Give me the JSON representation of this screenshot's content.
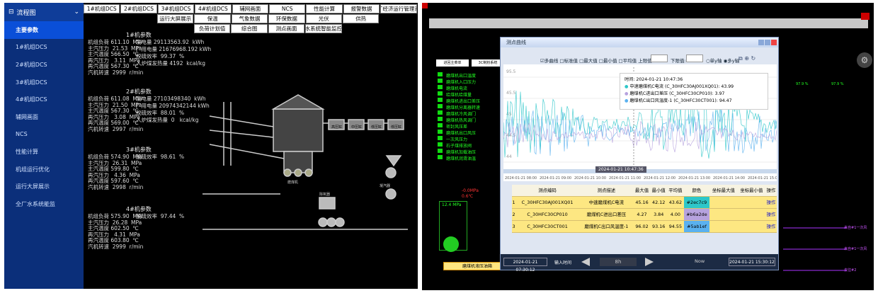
{
  "left_app": {
    "title": "流程图",
    "sidebar": [
      {
        "label": "主要参数",
        "active": true
      },
      {
        "label": "1#机组DCS"
      },
      {
        "label": "2#机组DCS"
      },
      {
        "label": "3#机组DCS"
      },
      {
        "label": "4#机组DCS"
      },
      {
        "label": "辅网画面"
      },
      {
        "label": "NCS"
      },
      {
        "label": "性能计算"
      },
      {
        "label": "机组运行优化"
      },
      {
        "label": "运行大屏展示"
      },
      {
        "label": "全厂水系统能监"
      }
    ],
    "topbar_row1": [
      "1#机组DCS",
      "2#机组DCS",
      "3#机组DCS",
      "4#机组DCS",
      "辅网画面",
      "NCS",
      "性能计算",
      "报警数据",
      "全厂经济运行管理系统"
    ],
    "topbar_row2": [
      "运行大屏展示",
      "保温",
      "气象数据",
      "环保数据",
      "光伏",
      "供热"
    ],
    "topbar_row3": [
      "负荷计划值",
      "综合图",
      "测点画面",
      "水系统智能监控"
    ],
    "units": [
      {
        "title": "1#机参数",
        "lines": [
          "机组负荷 611.10  MW",
          "主汽压力  21.53  MPa",
          "主汽温度 566.50  ℃",
          "再汽压力   3.11  MPa",
          "再汽温度 567.30  ℃",
          "汽机转速  2999  r/min"
        ],
        "extra": [
          "发电量 29113563.92  kWh",
          "厂用电量 21676968.192 kWh",
          "脱硫效率  99.37  %",
          "入炉煤发热量 4192  kcal/kg"
        ]
      },
      {
        "title": "2#机参数",
        "lines": [
          "机组负荷 611.08  MW",
          "主汽压力  21.50  MPa",
          "主汽温度 567.30  ℃",
          "再汽压力   3.08  MPa",
          "再汽温度 569.00  ℃",
          "汽机转速  2997  r/min"
        ],
        "extra": [
          "发电量 27103498340  kWh",
          "厂用电量 20974342144 kWh",
          "脱硫效率  88.01  %",
          "入炉煤发热量  0   kcal/kg"
        ]
      },
      {
        "title": "3#机参数",
        "lines": [
          "机组负荷 574.90  MW",
          "主汽压力  26.31  MPa",
          "主汽温度 599.80  ℃",
          "再汽压力   4.36  MPa",
          "再汽温度 597.60  ℃",
          "汽机转速  2998  r/min"
        ],
        "extra": [
          "脱硫效率  98.61  %"
        ]
      },
      {
        "title": "4#机参数",
        "lines": [
          "机组负荷 575.90  MW",
          "主汽压力  26.28  MPa",
          "主汽温度 602.50  ℃",
          "再汽压力   4.31  MPa",
          "再汽温度 603.80  ℃",
          "汽机转速  2999  r/min"
        ],
        "extra": [
          "脱硫效率  97.44  %"
        ]
      }
    ],
    "diagram_labels": [
      "高压缸",
      "中压缸",
      "低压缸",
      "低压缸",
      "凝汽器",
      "除氧器",
      "磨煤机"
    ]
  },
  "right_app": {
    "buttons": [
      "进回主菜单",
      "3C制粉系统"
    ],
    "green_list": [
      "磨煤机出口温度",
      "磨煤机入口压力",
      "磨煤机电流",
      "给煤机给煤量",
      "磨煤机进出口差压",
      "磨煤机分离器转速",
      "磨煤机冷风调门",
      "磨煤机热风调门",
      "密封风压差",
      "磨煤机出口风压",
      "一次风压力",
      "石子煤排放阀",
      "磨煤机加载油压",
      "磨煤机润滑油温"
    ],
    "dialog": {
      "title": "测点曲线",
      "toolbar": "☑多曲线 □标准值 □最大值 □最小值 □平均值 上限值:",
      "lower_label": "下限值:",
      "radio": "○单y轴 ◉多y轴",
      "tooltip_time": "时间: 2024-01-21 10:47:36",
      "tooltip_rows": [
        {
          "text": "中速磨煤机C电流 (C_30HFC30AJ001XQ01): 43.99",
          "color": "#2ec7c9"
        },
        {
          "text": "磨煤机C进出口差压 (C_30HFC30CP010): 3.97",
          "color": "#b6a2de"
        },
        {
          "text": "磨煤机C出口风温度-1 (C_30HFC30CT001): 94.47",
          "color": "#5ab1ef"
        }
      ],
      "y_left_ticks": [
        "95.5",
        "45.5",
        "45",
        "44.5",
        "44"
      ],
      "x_ticks": [
        "2024-01-21 08:00",
        "2024-01-21 09:00",
        "2024-01-21 10:00",
        "2024-01-21 11:00",
        "2024-01-21 12:00",
        "2024-01-21 13:00",
        "2024-01-21 14:00",
        "2024-01-21 15:00"
      ],
      "cursor_label": "2024-01-21 10:47:36",
      "table_headers": [
        "",
        "测点编码",
        "测点描述",
        "最大值",
        "最小值",
        "平均值",
        "颜色",
        "坐标最大值",
        "坐标最小值",
        "操作"
      ],
      "table_rows": [
        [
          "1",
          "C_30HFC30AJ001XQ01",
          "中速磨煤机C电流",
          "45.16",
          "42.12",
          "43.62",
          "#2ec7c9",
          "",
          "",
          "操作"
        ],
        [
          "2",
          "C_30HFC30CP010",
          "磨煤机C进出口差压",
          "4.27",
          "3.84",
          "4.00",
          "#b6a2de",
          "",
          "",
          "操作"
        ],
        [
          "3",
          "C_30HFC30CT001",
          "磨煤机C出口风温度-1",
          "96.02",
          "93.16",
          "94.55",
          "#5ab1ef",
          "",
          "",
          "操作"
        ]
      ],
      "time_start": "2024-01-21 07:30:12",
      "time_input_label": "输入时间",
      "span": "8h",
      "now": "Now",
      "time_end": "2024-01-21 15:30:12"
    },
    "side_values": [
      "97.9 %",
      "97.9 %"
    ],
    "bottom_label": "磨煤机液压油箱",
    "pressure_labels": [
      "-0.0MPa",
      "0.6℃",
      "12.4 MPa"
    ],
    "right_labels": [
      "来自#1一次风",
      "来自#1一次风",
      "去往#2"
    ]
  }
}
